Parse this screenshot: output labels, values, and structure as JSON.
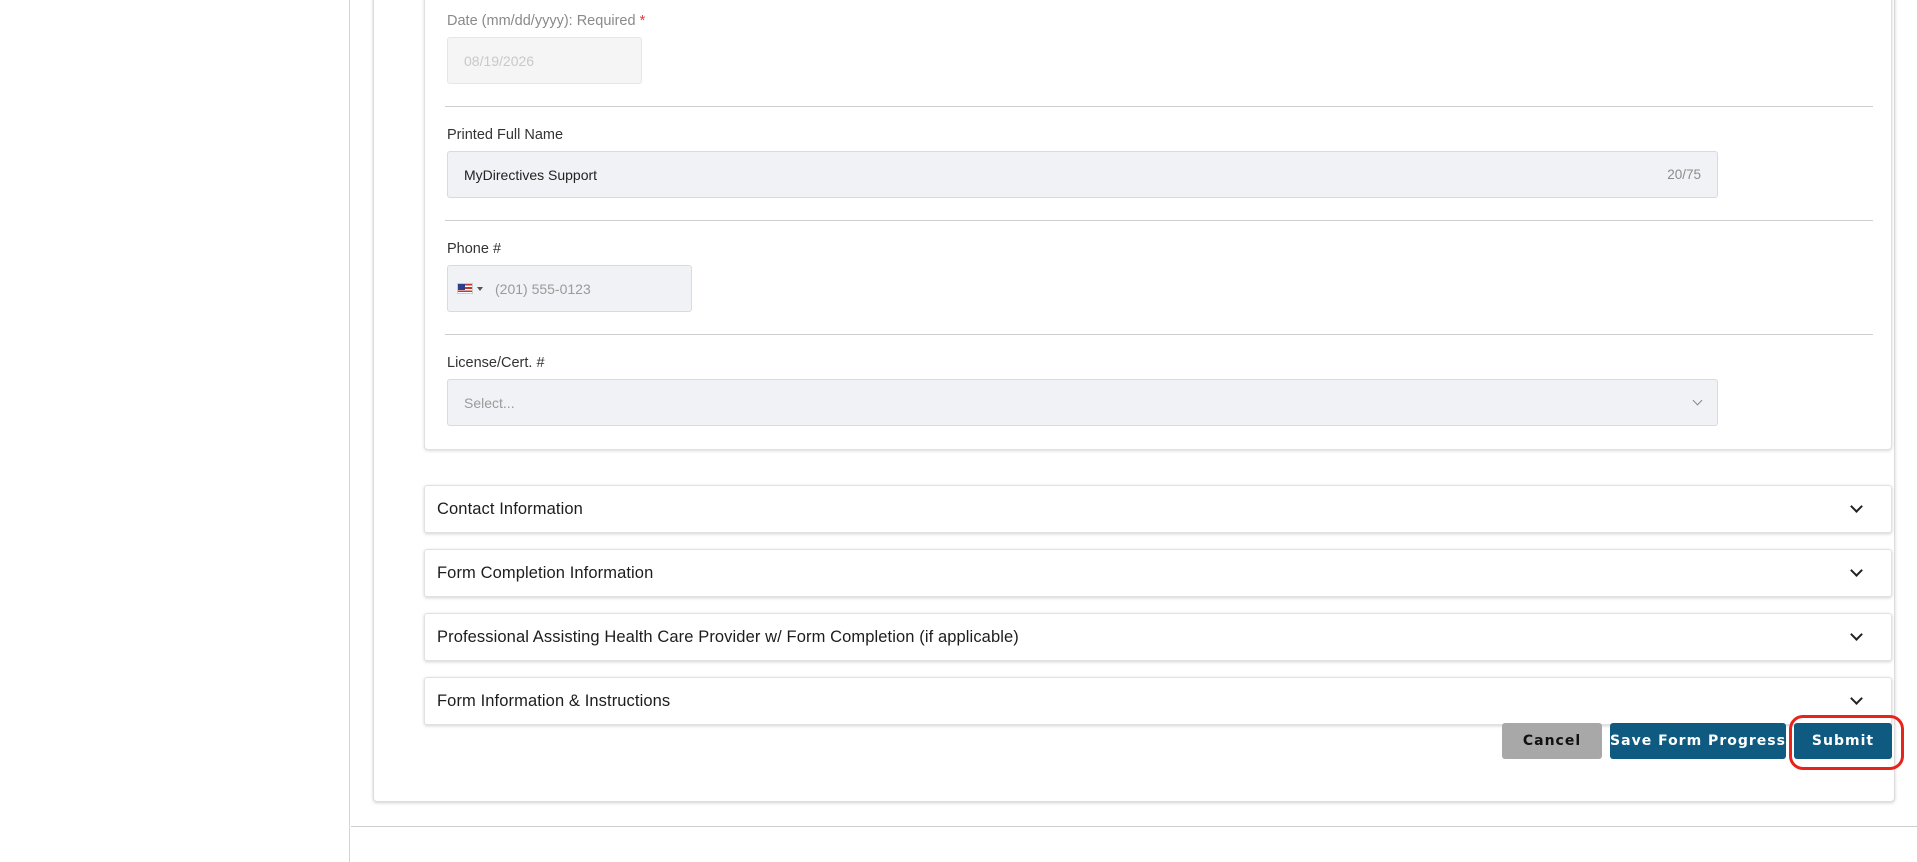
{
  "form": {
    "date_label": "Date (mm/dd/yyyy): Required",
    "date_required_mark": "*",
    "date_value": "08/19/2026",
    "name_label": "Printed Full Name",
    "name_value": "MyDirectives Support",
    "name_counter": "20/75",
    "phone_label": "Phone #",
    "phone_placeholder": "(201) 555-0123",
    "license_label": "License/Cert. #",
    "license_placeholder": "Select..."
  },
  "sections": [
    {
      "title": "Contact Information"
    },
    {
      "title": "Form Completion Information"
    },
    {
      "title": "Professional Assisting Health Care Provider w/ Form Completion (if applicable)"
    },
    {
      "title": "Form Information & Instructions"
    }
  ],
  "actions": {
    "cancel_label": "Cancel",
    "save_label": "Save Form Progress",
    "submit_label": "Submit"
  },
  "colors": {
    "primary": "#0e5a80",
    "cancel": "#a8a8a8",
    "highlight": "#e8231b",
    "required": "#e53935"
  }
}
